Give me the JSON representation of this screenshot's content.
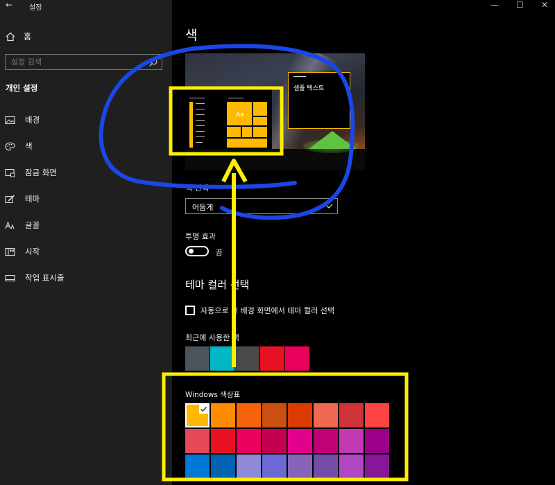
{
  "window": {
    "title": "설정",
    "back_glyph": "←",
    "minimize_glyph": "—",
    "maximize_glyph": "☐",
    "close_glyph": "✕"
  },
  "sidebar": {
    "home_label": "홈",
    "search_placeholder": "설정 검색",
    "section_title": "개인 설정",
    "items": [
      {
        "label": "배경",
        "icon": "picture-icon"
      },
      {
        "label": "색",
        "icon": "palette-icon"
      },
      {
        "label": "잠금 화면",
        "icon": "lock-screen-icon"
      },
      {
        "label": "테마",
        "icon": "theme-brush-icon"
      },
      {
        "label": "글꼴",
        "icon": "font-icon"
      },
      {
        "label": "시작",
        "icon": "start-icon"
      },
      {
        "label": "작업 표시줄",
        "icon": "taskbar-icon"
      }
    ]
  },
  "main": {
    "page_title": "색",
    "preview": {
      "sample_text": "샘플 텍스트",
      "tile_text": "Aa"
    },
    "mode": {
      "label": "색 선택",
      "value": "어둡게"
    },
    "transparency": {
      "label": "투명 효과",
      "state": "끔"
    },
    "accent_heading": "테마 컬러 선택",
    "auto_pick_label": "자동으로 내 배경 화면에서 테마 컬러 선택",
    "recent_label": "최근에 사용한 색",
    "recent_colors": [
      "#4c5459",
      "#00b7c3",
      "#4c4a48",
      "#e81123",
      "#ea005e"
    ],
    "windows_colors_label": "Windows 색상표",
    "windows_colors": [
      "#ffb900",
      "#ff8c00",
      "#f7630c",
      "#ca5010",
      "#da3b01",
      "#ef6950",
      "#d13438",
      "#ff4343",
      "#e74856",
      "#e81123",
      "#ea005e",
      "#c30052",
      "#e3008c",
      "#bf0077",
      "#c239b3",
      "#9a0089",
      "#0078d7",
      "#0063b1",
      "#8e8cd8",
      "#6b69d6",
      "#8764b8",
      "#744da9",
      "#b146c2",
      "#881798"
    ],
    "selected_color_index": 0,
    "accent_color": "#ffb900"
  }
}
